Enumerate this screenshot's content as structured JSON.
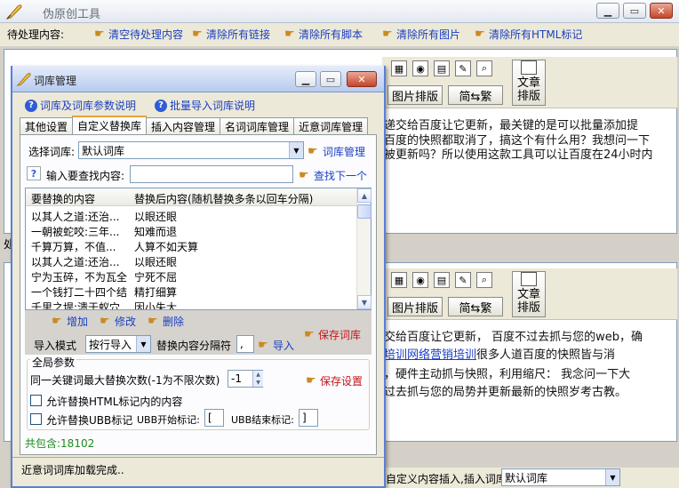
{
  "main": {
    "title": "伪原创工具",
    "toolbar": {
      "label": "待处理内容:",
      "buttons": [
        "清空待处理内容",
        "清除所有链接",
        "清除所有脚本",
        "清除所有图片",
        "清除所有HTML标记"
      ]
    }
  },
  "editor_toolbar": {
    "image_sort": "图片排版",
    "simp_trad": "简⇆繁",
    "doc_sort_1": "文章",
    "doc_sort_2": "排版"
  },
  "top_panel_lines": [
    "递交给百度让它更新，最关键的是可以批量添加提",
    "百度的快照都取消了，搞这个有什么用？我想问一下",
    "被更新吗？所以使用这款工具可以让百度在24小时内"
  ],
  "mid_panel_lines": [
    {
      "pre": "交给百度让它更新，  百度不过去抓与您的web，确",
      "link": "",
      "post": ""
    },
    {
      "pre": "",
      "link": "培训网络营销培训",
      "post": "很多人道百度的快照皆与消"
    },
    {
      "pre": "，硬件主动抓与快照，利用缩尺：  我念问一下大",
      "link": "",
      "post": ""
    },
    {
      "pre": "过去抓与您的局势并更新最新的快照岁考古教。",
      "link": "",
      "post": ""
    }
  ],
  "bottom_bar": {
    "label": "自定义内容插入,插入词库:",
    "select": "默认词库"
  },
  "side_labels": [
    "处"
  ],
  "dialog": {
    "title": "词库管理",
    "help_links": [
      "词库及词库参数说明",
      "批量导入词库说明"
    ],
    "tabs": [
      "其他设置",
      "自定义替换库",
      "插入内容管理",
      "名词词库管理",
      "近意词库管理"
    ],
    "active_tab": 1,
    "select_label": "选择词库:",
    "select_value": "默认词库",
    "manage_link": "词库管理",
    "search_label": "输入要查找内容:",
    "find_next": "查找下一个",
    "columns": [
      "要替换的内容",
      "替换后内容(随机替换多条以回车分隔)"
    ],
    "rows": [
      [
        "以其人之道:还治...",
        "以眼还眼"
      ],
      [
        "一朝被蛇咬:三年...",
        "知难而退"
      ],
      [
        "千算万算，不值...",
        "人算不如天算"
      ],
      [
        "以其人之道:还治...",
        "以眼还眼"
      ],
      [
        "宁为玉碎，不为瓦全",
        "宁死不屈"
      ],
      [
        "一个钱打二十四个结",
        "精打细算"
      ],
      [
        "千里之堤:溃于蚁穴",
        "因小失大"
      ]
    ],
    "actions": [
      "增加",
      "修改",
      "删除"
    ],
    "save_lib": "保存词库",
    "import_mode_label": "导入模式",
    "import_mode_value": "按行导入",
    "separator_label": "替换内容分隔符",
    "separator_value": ",",
    "import_btn": "导入",
    "global_title": "全局参数",
    "max_replace_label": "同一关键词最大替换次数(-1为不限次数)",
    "max_replace_value": "-1",
    "save_settings": "保存设置",
    "allow_html": "允许替换HTML标记内的内容",
    "allow_ubb": "允许替换UBB标记",
    "ubb_start_label": "UBB开始标记:",
    "ubb_start_value": "[",
    "ubb_end_label": "UBB结束标记:",
    "ubb_end_value": "]",
    "total": "共包含:18102",
    "status": "近意词词库加载完成.."
  },
  "colors": {
    "link": "#1a3ec2",
    "red": "#c4161c",
    "green_total": "#1b8a1b"
  }
}
